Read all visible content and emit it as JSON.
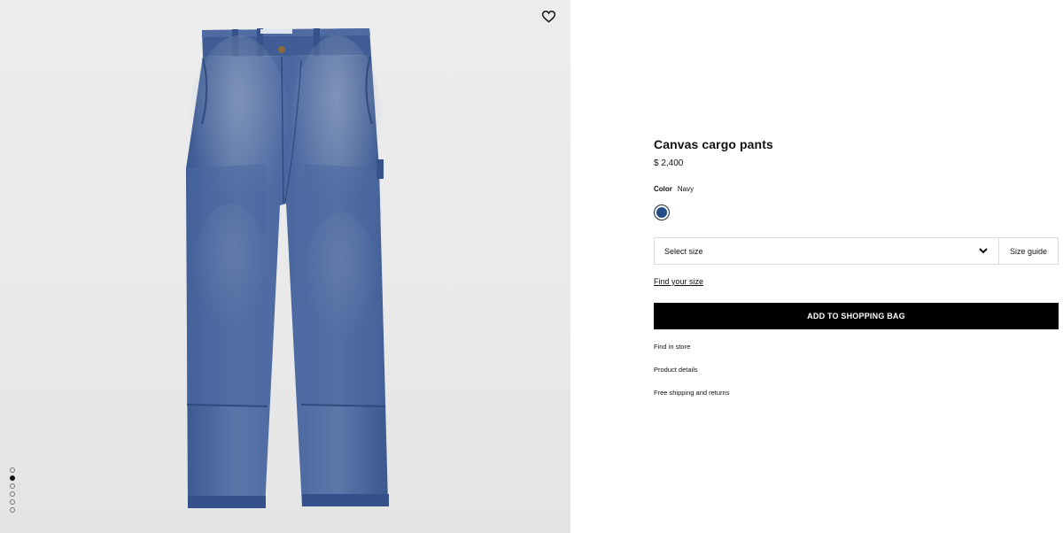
{
  "product": {
    "title": "Canvas cargo pants",
    "price": "$ 2,400",
    "color_label": "Color",
    "color_value": "Navy",
    "swatch_color": "#234e87"
  },
  "gallery": {
    "image_count": 6,
    "active_index": 1
  },
  "size": {
    "select_label": "Select size",
    "guide_label": "Size guide",
    "find_label": "Find your size"
  },
  "actions": {
    "add_to_bag": "ADD TO SHOPPING BAG"
  },
  "links": {
    "find_in_store": "Find in store",
    "product_details": "Product details",
    "shipping": "Free shipping and returns"
  },
  "icons": {
    "wishlist": "heart-icon",
    "dropdown": "chevron-down-icon"
  }
}
